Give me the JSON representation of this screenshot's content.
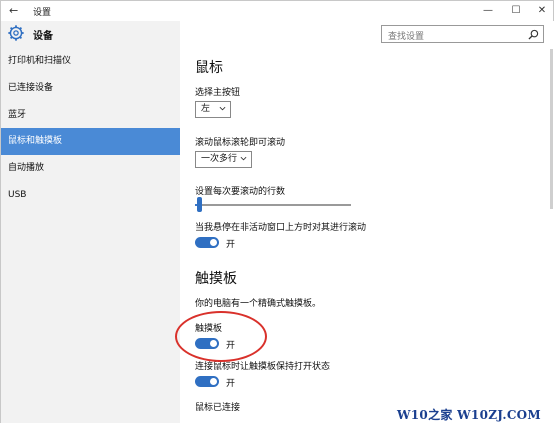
{
  "window": {
    "title": "设置"
  },
  "sidebar": {
    "title": "设备",
    "items": [
      {
        "label": "打印机和扫描仪",
        "active": false
      },
      {
        "label": "已连接设备",
        "active": false
      },
      {
        "label": "蓝牙",
        "active": false
      },
      {
        "label": "鼠标和触摸板",
        "active": true
      },
      {
        "label": "自动播放",
        "active": false
      },
      {
        "label": "USB",
        "active": false
      }
    ]
  },
  "search": {
    "placeholder": "查找设置"
  },
  "mouse": {
    "heading": "鼠标",
    "primary_button_label": "选择主按钮",
    "primary_button_value": "左",
    "scroll_label": "滚动鼠标滚轮即可滚动",
    "scroll_value": "一次多行",
    "lines_label": "设置每次要滚动的行数",
    "lines_fraction": 0.02,
    "inactive_scroll_label": "当我悬停在非活动窗口上方时对其进行滚动",
    "inactive_scroll_state": "开"
  },
  "touchpad": {
    "heading": "触摸板",
    "description": "你的电脑有一个精确式触摸板。",
    "touchpad_label": "触摸板",
    "touchpad_state": "开",
    "keep_on_label": "连接鼠标时让触摸板保持打开状态",
    "keep_on_state": "开",
    "mouse_connected_label": "鼠标已连接"
  },
  "watermark": "W10之家 W10ZJ.COM",
  "colors": {
    "accent": "#2f6fc2",
    "sidebar_active": "#4a8ad6",
    "annotation": "#d9312b"
  }
}
